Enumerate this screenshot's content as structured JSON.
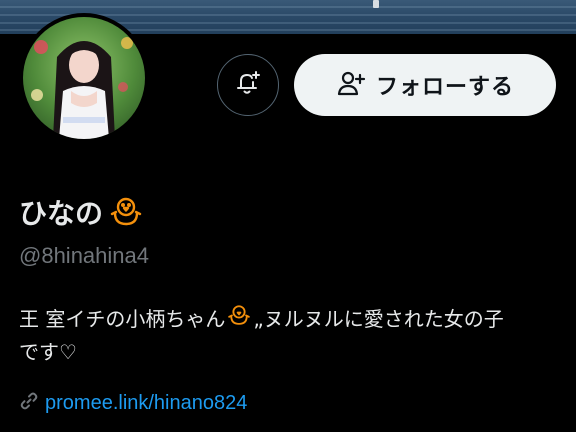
{
  "profile": {
    "display_name": "ひなの",
    "handle": "@8hinahina4",
    "bio_line1_part1": "王 室イチの小柄ちゃん",
    "bio_line1_part2": "„ヌルヌルに愛された女の子",
    "bio_line2": "です♡",
    "link": "promee.link/hinano824"
  },
  "actions": {
    "follow_label": "フォローする",
    "notify_icon": "bell-plus-icon",
    "follow_icon": "person-plus-icon"
  },
  "icons": {
    "name_emoji": "chick-icon",
    "bio_emoji": "chick-icon",
    "link_icon": "link-icon"
  },
  "colors": {
    "background": "#000000",
    "text_primary": "#e7e9ea",
    "text_secondary": "#71767b",
    "link": "#1d9bf0",
    "follow_button_bg": "#eff3f4",
    "follow_button_text": "#0f1419",
    "outline": "#536471",
    "emoji_orange": "#f4900c"
  }
}
